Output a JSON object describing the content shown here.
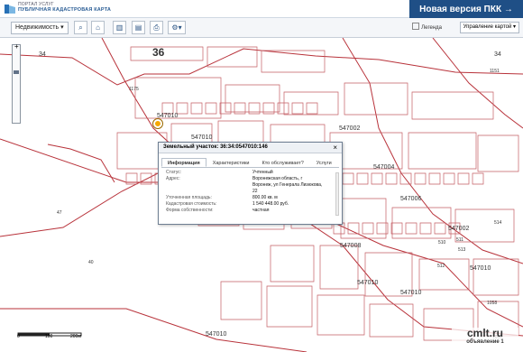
{
  "header": {
    "portal": "ПОРТАЛ УСЛУГ",
    "title": "ПУБЛИЧНАЯ КАДАСТРОВАЯ КАРТА",
    "new_version": "Новая версия ПКК →"
  },
  "toolbar": {
    "property_select": "Недвижимость ▾",
    "legend": "Легенда",
    "layer_select": "Управление картой ▾"
  },
  "map": {
    "labels": [
      "34",
      "36",
      "34",
      "47",
      "40",
      "1175",
      "547010",
      "547010",
      "547002",
      "547004",
      "547006",
      "547008",
      "547002",
      "547010",
      "547010",
      "547010",
      "547010",
      "513",
      "512",
      "511",
      "514",
      "1151",
      "510",
      "1058",
      "1057"
    ],
    "scale": [
      "0",
      "100",
      "200м"
    ]
  },
  "popup": {
    "title": "Земельный участок: 36:34:0547010:146",
    "close": "×",
    "tabs": [
      "Информация",
      "Характеристики",
      "Кто обслуживает?",
      "Услуги"
    ],
    "info": [
      {
        "label": "Статус:",
        "value": "Учтенный"
      },
      {
        "label": "Адрес:",
        "value": "Воронежская область, г Воронеж, ул Генерала Лизюкова, 22"
      },
      {
        "label": "Уточненная площадь:",
        "value": "800.00 кв. м"
      },
      {
        "label": "Кадастровая стоимость:",
        "value": "1 540 448.00 руб."
      },
      {
        "label": "Форма собственности:",
        "value": "частная"
      }
    ]
  },
  "watermark": {
    "brand": "cmlt.ru",
    "sub": "объявление 1"
  }
}
